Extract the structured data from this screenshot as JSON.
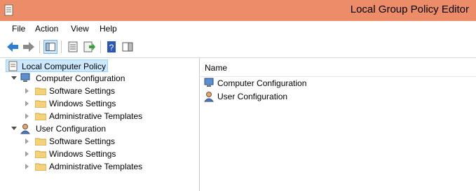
{
  "window": {
    "title": "Local Group Policy Editor"
  },
  "menu": {
    "items": [
      "File",
      "Action",
      "View",
      "Help"
    ]
  },
  "toolbar": {
    "buttons": [
      "back-icon",
      "forward-icon",
      "show-hide-console-tree-icon",
      "properties-icon",
      "export-list-icon",
      "help-icon",
      "show-action-pane-icon"
    ]
  },
  "tree": {
    "root": "Local Computer Policy",
    "computer": {
      "label": "Computer Configuration",
      "children": [
        "Software Settings",
        "Windows Settings",
        "Administrative Templates"
      ]
    },
    "user": {
      "label": "User Configuration",
      "children": [
        "Software Settings",
        "Windows Settings",
        "Administrative Templates"
      ]
    }
  },
  "list": {
    "column": "Name",
    "items": [
      "Computer Configuration",
      "User Configuration"
    ]
  },
  "colors": {
    "titlebar": "#ec8c69",
    "selection": "#cce8ff"
  }
}
